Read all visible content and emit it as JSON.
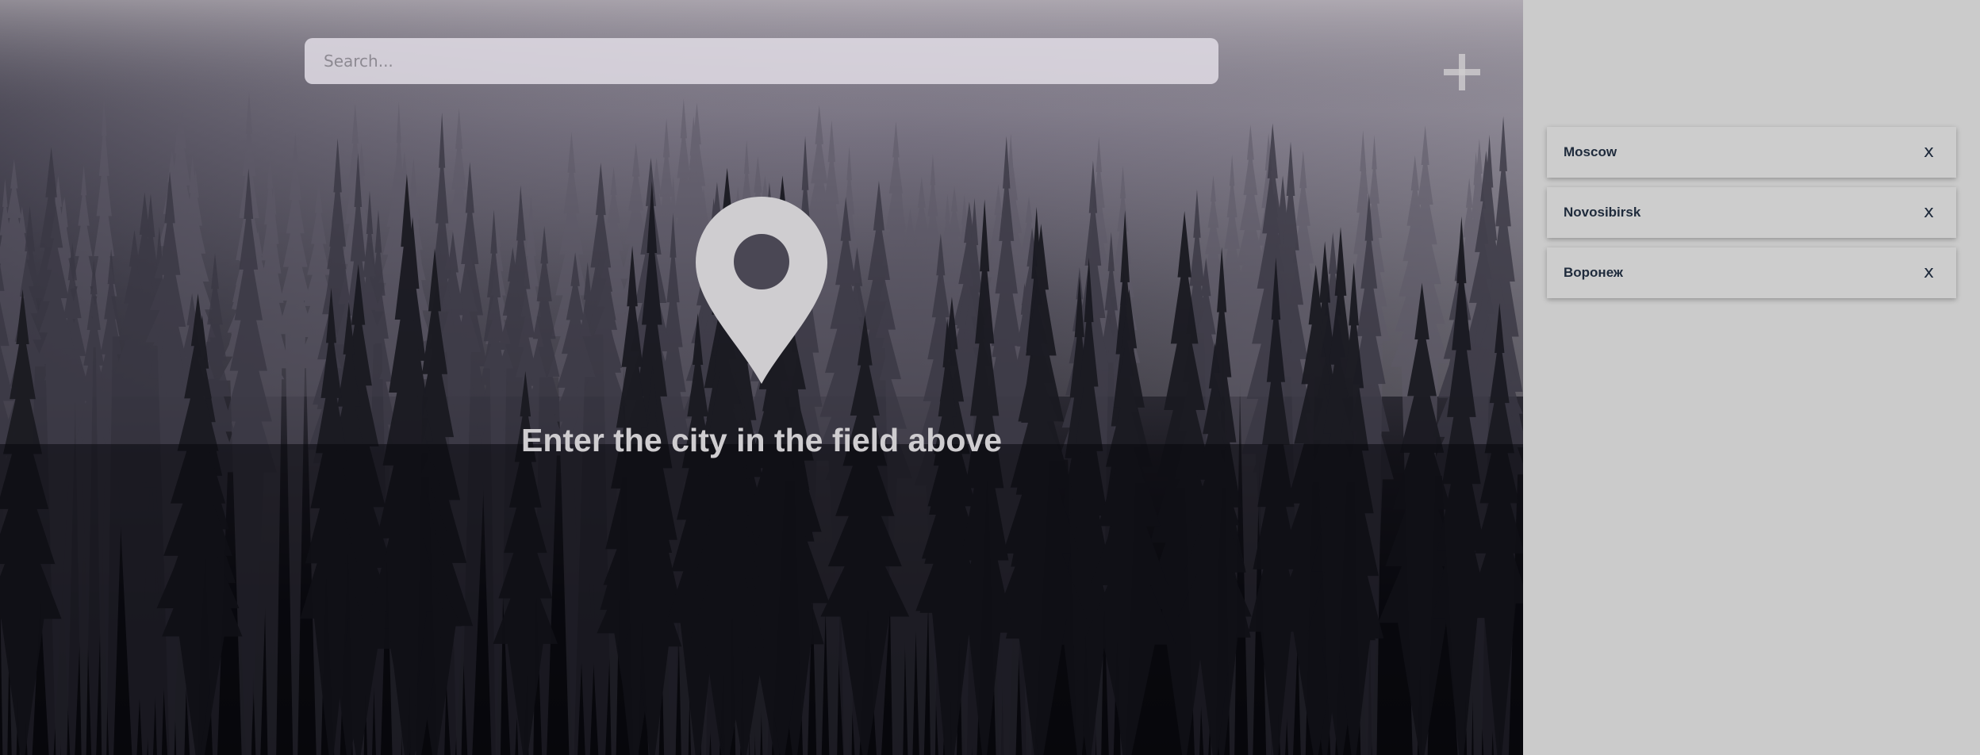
{
  "search": {
    "placeholder": "Search...",
    "value": ""
  },
  "toolbar": {
    "add_icon": "plus-icon"
  },
  "empty_state": {
    "icon": "map-pin-icon",
    "hint": "Enter the city in the field above"
  },
  "sidebar": {
    "cities": [
      {
        "name": "Moscow",
        "remove_label": "x"
      },
      {
        "name": "Novosibirsk",
        "remove_label": "x"
      },
      {
        "name": "Воронеж",
        "remove_label": "x"
      }
    ]
  },
  "colors": {
    "sidebar_bg": "#cbcbcb",
    "city_text": "#1f2b3c",
    "pin": "#cfcdd0"
  }
}
